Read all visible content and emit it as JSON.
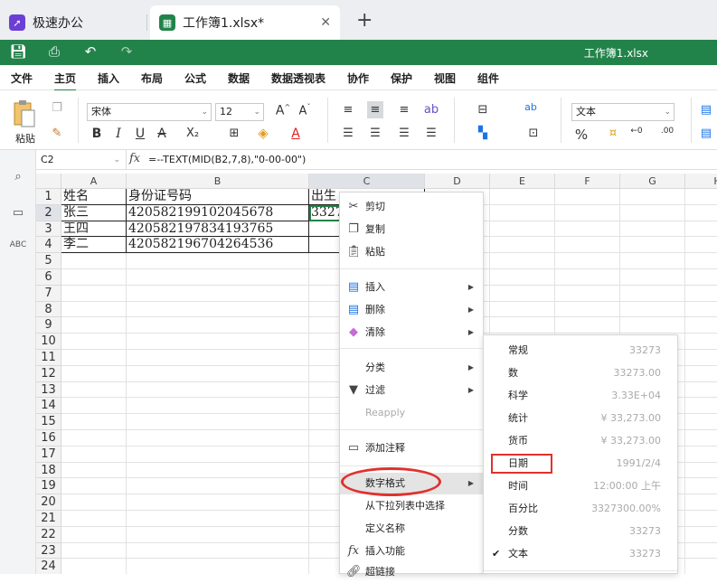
{
  "tabs": [
    {
      "label": "极速办公",
      "icon": "rocket-icon",
      "color": "#6b3fd6"
    },
    {
      "label": "工作簿1.xlsx*",
      "icon": "spreadsheet-icon",
      "color": "#22834a"
    }
  ],
  "document_title": "工作簿1.xlsx",
  "menu": [
    "文件",
    "主页",
    "插入",
    "布局",
    "公式",
    "数据",
    "数据透视表",
    "协作",
    "保护",
    "视图",
    "组件"
  ],
  "active_menu": "主页",
  "ribbon": {
    "paste_label": "粘贴",
    "font_name": "宋体",
    "font_size": "12",
    "number_format": "文本",
    "bold": "B",
    "italic": "I",
    "underline": "U",
    "strike": "A",
    "subscript": "X₂",
    "font_grow": "A",
    "font_shrink": "A",
    "font_color": "A",
    "percent": "%"
  },
  "formula_bar": {
    "cell_ref": "C2",
    "fx": "fx",
    "formula": "=--TEXT(MID(B2,7,8),\"0-00-00\")"
  },
  "columns": [
    "A",
    "B",
    "C",
    "D",
    "E",
    "F",
    "G",
    "H"
  ],
  "rows": [
    "1",
    "2",
    "3",
    "4",
    "5",
    "6",
    "7",
    "8",
    "9",
    "10",
    "11",
    "12",
    "13",
    "14",
    "15",
    "16",
    "17",
    "18",
    "19",
    "20",
    "21",
    "22",
    "23",
    "24"
  ],
  "cells": {
    "A1": "姓名",
    "B1": "身份证号码",
    "C1": "出生",
    "A2": "张三",
    "B2": "420582199102045678",
    "C2": "3327",
    "A3": "王四",
    "B3": "420582197834193765",
    "A4": "李二",
    "B4": "420582196704264536"
  },
  "context_menu": [
    {
      "label": "剪切",
      "icon": "scissors-icon"
    },
    {
      "label": "复制",
      "icon": "copy-icon"
    },
    {
      "label": "粘贴",
      "icon": "paste-icon"
    },
    {
      "label": "插入",
      "icon": "insert-cells-icon",
      "submenu": true
    },
    {
      "label": "删除",
      "icon": "delete-cells-icon",
      "submenu": true
    },
    {
      "label": "清除",
      "icon": "eraser-icon",
      "submenu": true
    },
    {
      "label": "分类",
      "submenu": true
    },
    {
      "label": "过滤",
      "icon": "filter-icon",
      "submenu": true
    },
    {
      "label": "Reapply",
      "disabled": true
    },
    {
      "label": "添加注释",
      "icon": "comment-icon"
    },
    {
      "label": "数字格式",
      "submenu": true,
      "highlighted": true
    },
    {
      "label": "从下拉列表中选择"
    },
    {
      "label": "定义名称"
    },
    {
      "label": "插入功能",
      "icon": "function-icon"
    },
    {
      "label": "超链接",
      "icon": "link-icon"
    }
  ],
  "number_format_submenu": [
    {
      "label": "常规",
      "sample": "33273"
    },
    {
      "label": "数",
      "sample": "33273.00"
    },
    {
      "label": "科学",
      "sample": "3.33E+04"
    },
    {
      "label": "统计",
      "sample": "¥ 33,273.00"
    },
    {
      "label": "货币",
      "sample": "¥ 33,273.00"
    },
    {
      "label": "日期",
      "sample": "1991/2/4"
    },
    {
      "label": "时间",
      "sample": "12:00:00 上午"
    },
    {
      "label": "百分比",
      "sample": "3327300.00%"
    },
    {
      "label": "分数",
      "sample": "33273"
    },
    {
      "label": "文本",
      "sample": "33273",
      "checked": true
    }
  ],
  "colors": {
    "brand_green": "#22834a",
    "annotation_red": "#e0312d"
  }
}
